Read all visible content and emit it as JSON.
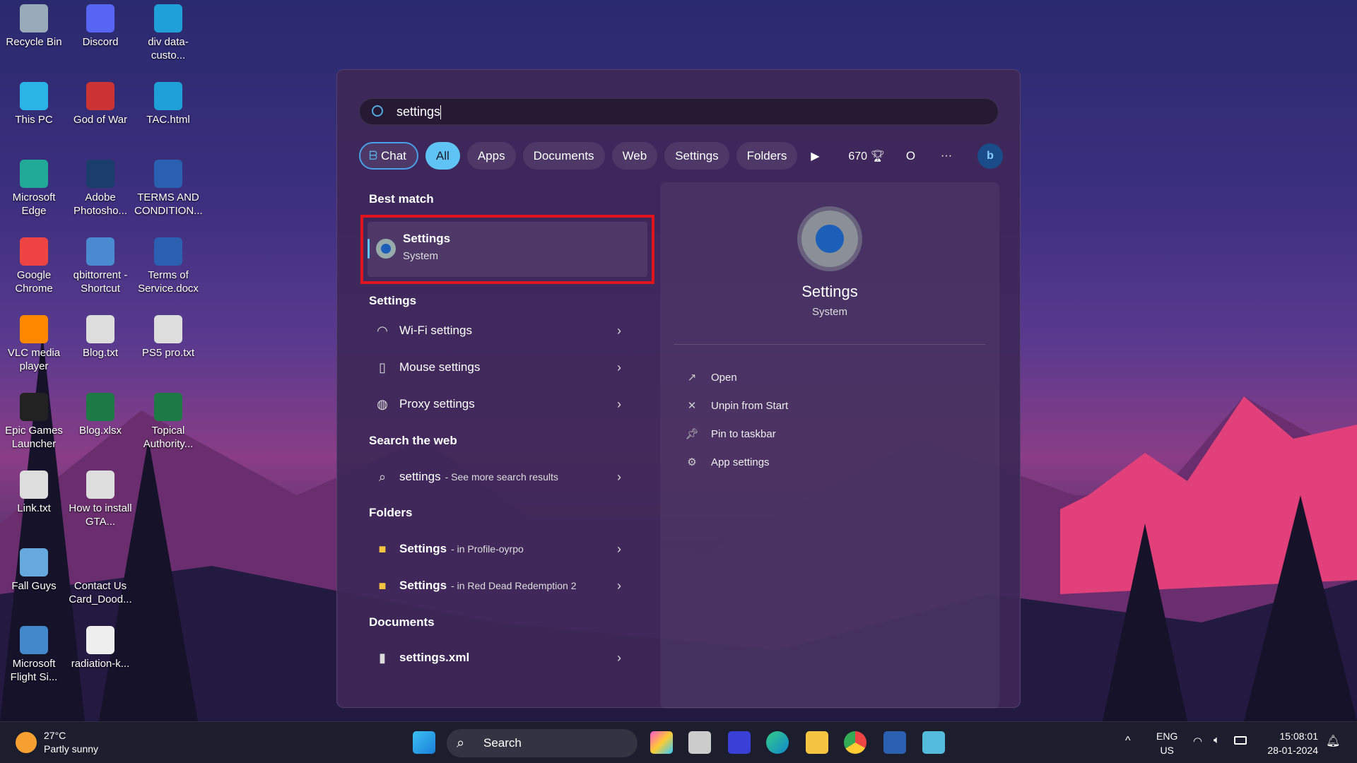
{
  "desktop": {
    "icons": [
      {
        "label": "Recycle Bin",
        "color": "#9ab"
      },
      {
        "label": "Discord",
        "color": "#5865f2"
      },
      {
        "label": "div data-custo...",
        "color": "#1fa0d8"
      },
      {
        "label": "This PC",
        "color": "#2bb5e6"
      },
      {
        "label": "God of War",
        "color": "#c33"
      },
      {
        "label": "TAC.html",
        "color": "#1fa0d8"
      },
      {
        "label": "Microsoft Edge",
        "color": "#2a9"
      },
      {
        "label": "Adobe Photosho...",
        "color": "#1a3d6e"
      },
      {
        "label": "TERMS AND CONDITION...",
        "color": "#2b5fb0"
      },
      {
        "label": "Google Chrome",
        "color": "#e44"
      },
      {
        "label": "qbittorrent - Shortcut",
        "color": "#4a8ad0"
      },
      {
        "label": "Terms of Service.docx",
        "color": "#2b5fb0"
      },
      {
        "label": "VLC media player",
        "color": "#f80"
      },
      {
        "label": "Blog.txt",
        "color": "#ddd"
      },
      {
        "label": "PS5 pro.txt",
        "color": "#ddd"
      },
      {
        "label": "Epic Games Launcher",
        "color": "#222"
      },
      {
        "label": "Blog.xlsx",
        "color": "#1d7a45"
      },
      {
        "label": "Topical Authority...",
        "color": "#1d7a45"
      },
      {
        "label": "Link.txt",
        "color": "#ddd"
      },
      {
        "label": "How to install GTA...",
        "color": "#ddd"
      },
      {
        "label": "",
        "color": ""
      },
      {
        "label": "Fall Guys",
        "color": "#6ad"
      },
      {
        "label": "Contact Us Card_Dood...",
        "color": ""
      },
      {
        "label": "",
        "color": ""
      },
      {
        "label": "Microsoft Flight Si...",
        "color": "#48c"
      },
      {
        "label": "radiation-k...",
        "color": "#eee"
      }
    ]
  },
  "search": {
    "query": "settings"
  },
  "filters": {
    "chat": "Chat",
    "all": "All",
    "apps": "Apps",
    "documents": "Documents",
    "web": "Web",
    "settings": "Settings",
    "folders": "Folders",
    "points": "670",
    "profile": "O",
    "more": "···"
  },
  "results": {
    "best_match_header": "Best match",
    "best": {
      "title": "Settings",
      "subtitle": "System"
    },
    "settings_header": "Settings",
    "settings_items": [
      {
        "label": "Wi-Fi settings",
        "icon": "wifi-icon"
      },
      {
        "label": "Mouse settings",
        "icon": "mouse-icon"
      },
      {
        "label": "Proxy settings",
        "icon": "globe-icon"
      }
    ],
    "web_header": "Search the web",
    "web_item": {
      "label": "settings",
      "sub": "- See more search results"
    },
    "folders_header": "Folders",
    "folders": [
      {
        "label": "Settings",
        "sub": "- in Profile-oyrpo"
      },
      {
        "label": "Settings",
        "sub": "- in Red Dead Redemption 2"
      }
    ],
    "documents_header": "Documents",
    "documents": [
      {
        "label": "settings.xml"
      }
    ]
  },
  "detail": {
    "title": "Settings",
    "subtitle": "System",
    "actions": [
      "Open",
      "Unpin from Start",
      "Pin to taskbar",
      "App settings"
    ]
  },
  "taskbar": {
    "weather_temp": "27°C",
    "weather_desc": "Partly sunny",
    "search_label": "Search",
    "lang1": "ENG",
    "lang2": "US",
    "time": "15:08:01",
    "date": "28-01-2024"
  },
  "colors": {
    "accent": "#5fc4f5",
    "highlight_border": "#e0141e"
  }
}
